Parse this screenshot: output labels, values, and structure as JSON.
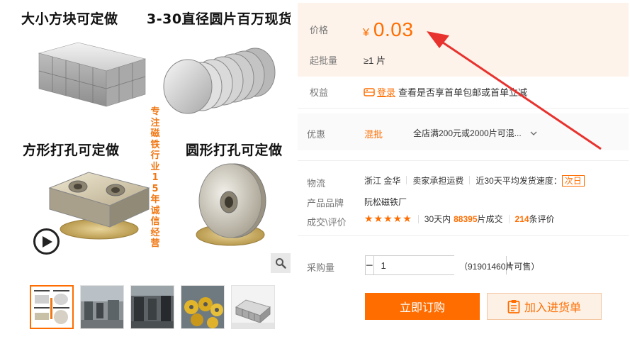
{
  "gallery": {
    "quadrants": {
      "top_left": "大小方块可定做",
      "top_right": "3-30直径圆片百万现货",
      "bottom_left": "方形打孔可定做",
      "bottom_right": "圆形打孔可定做"
    },
    "vertical_slogan": "专注磁铁行业15年诚信经营",
    "play_icon": "play-icon",
    "zoom_icon": "magnifier-icon",
    "thumbnails": [
      "thumb-1",
      "thumb-2",
      "thumb-3",
      "thumb-4",
      "thumb-5"
    ]
  },
  "info": {
    "price_label": "价格",
    "currency": "¥",
    "price": "0.03",
    "moq_label": "起批量",
    "moq_value": "≥1 片",
    "rights_label": "权益",
    "rights_login": "登录",
    "rights_text": "查看是否享首单包邮或首单立减",
    "promo_label": "优惠",
    "promo_tag": "混批",
    "promo_text": "全店满200元或2000片可混...",
    "logistics_label": "物流",
    "logistics_origin": "浙江 金华",
    "logistics_freight": "卖家承担运费",
    "logistics_speed": "近30天平均发货速度：",
    "logistics_speed_value": "次日",
    "brand_label": "产品品牌",
    "brand_value": "阮松磁铁厂",
    "deal_label": "成交\\评价",
    "stars": "★★★★★",
    "deal_prefix": "30天内",
    "deal_count": "88395",
    "deal_suffix": "片成交",
    "review_count": "214",
    "review_suffix": "条评价",
    "qty_label": "采购量",
    "qty_minus": "−",
    "qty_value": "1",
    "qty_plus": "+",
    "stock_text": "（91901460片可售）",
    "buy_button": "立即订购",
    "cart_button": "加入进货单"
  },
  "colors": {
    "accent": "#ff6d00",
    "price_bg": "#fdf3ea",
    "arrow": "#e8322e"
  }
}
